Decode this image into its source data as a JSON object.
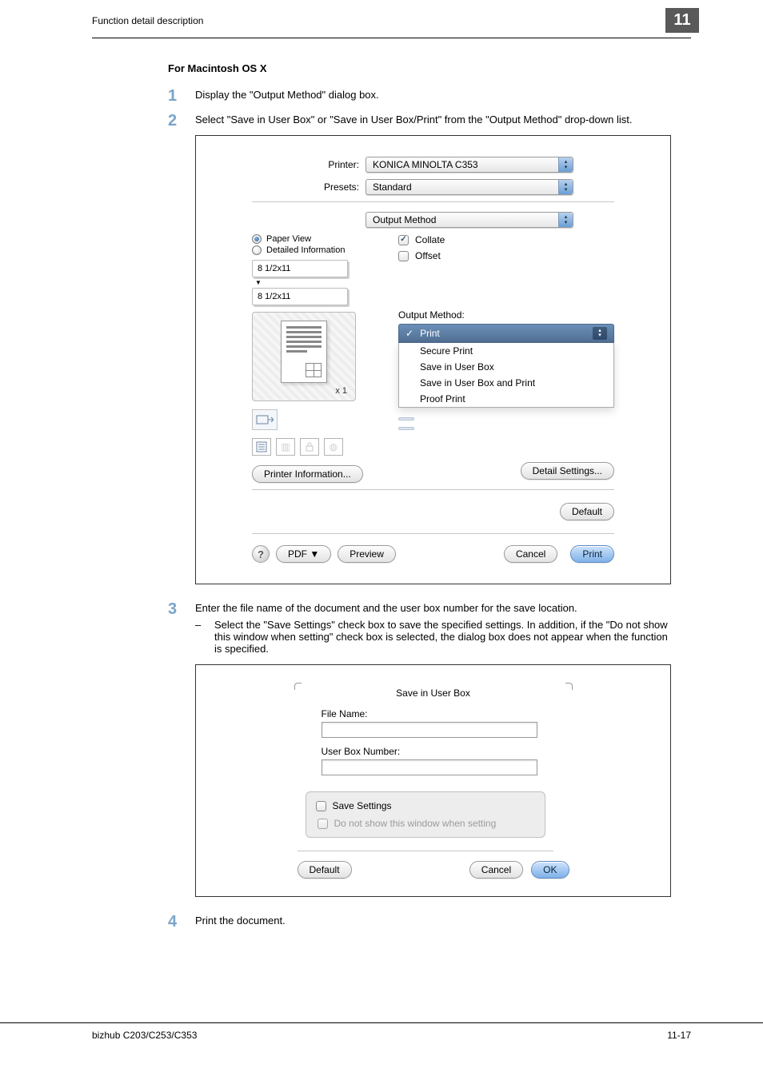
{
  "header": {
    "left": "Function detail description",
    "chapter_number": "11"
  },
  "section": {
    "heading": "For Macintosh OS X"
  },
  "steps": {
    "s1": "Display the \"Output Method\" dialog box.",
    "s2": "Select \"Save in User Box\" or \"Save in User Box/Print\" from the \"Output Method\" drop-down list.",
    "s3": "Enter the file name of the document and the user box number for the save location.",
    "s3_sub": "Select the \"Save Settings\" check box to save the specified settings. In addition, if the \"Do not show this window when setting\" check box is selected, the dialog box does not appear when the function is specified.",
    "s4": "Print the document."
  },
  "dialog1": {
    "printer_label": "Printer:",
    "printer_value": "KONICA MINOLTA C353",
    "presets_label": "Presets:",
    "presets_value": "Standard",
    "panel_value": "Output Method",
    "paperview": "Paper View",
    "detailedinfo": "Detailed Information",
    "size1": "8 1/2x11",
    "size2": "8 1/2x11",
    "x1": "x 1",
    "collate": "Collate",
    "offset": "Offset",
    "output_method_label": "Output Method:",
    "dd_selected": "Print",
    "dd_options": {
      "o1": "Secure Print",
      "o2": "Save in User Box",
      "o3": "Save in User Box and Print",
      "o4": "Proof Print"
    },
    "printer_info_btn": "Printer Information...",
    "detail_settings_btn": "Detail Settings...",
    "default_btn": "Default",
    "pdf_btn": "PDF ▼",
    "preview_btn": "Preview",
    "cancel_btn": "Cancel",
    "print_btn": "Print"
  },
  "dialog2": {
    "title": "Save in User Box",
    "file_name_label": "File Name:",
    "userbox_label": "User Box Number:",
    "save_settings": "Save Settings",
    "do_not_show": "Do not show this window when setting",
    "default_btn": "Default",
    "cancel_btn": "Cancel",
    "ok_btn": "OK"
  },
  "footer": {
    "left": "bizhub C203/C253/C353",
    "right": "11-17"
  }
}
